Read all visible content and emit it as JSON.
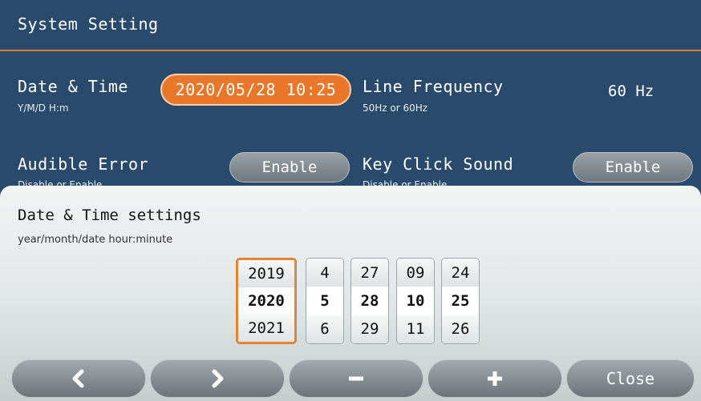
{
  "header": {
    "title": "System Setting"
  },
  "settings": {
    "date_time": {
      "label": "Date & Time",
      "sub": "Y/M/D H:m",
      "value": "2020/05/28 10:25"
    },
    "line_frequency": {
      "label": "Line Frequency",
      "sub": "50Hz or 60Hz",
      "value": "60 Hz"
    },
    "audible_error": {
      "label": "Audible Error",
      "sub": "Disable or Enable",
      "value": "Enable"
    },
    "key_click": {
      "label": "Key Click Sound",
      "sub": "Disable or Enable",
      "value": "Enable"
    }
  },
  "panel": {
    "title": "Date & Time settings",
    "sub": "year/month/date hour:minute",
    "columns": [
      {
        "name": "year",
        "values": [
          "2019",
          "2020",
          "2021"
        ],
        "active": true
      },
      {
        "name": "month",
        "values": [
          "4",
          "5",
          "6"
        ],
        "active": false
      },
      {
        "name": "date",
        "values": [
          "27",
          "28",
          "29"
        ],
        "active": false
      },
      {
        "name": "hour",
        "values": [
          "09",
          "10",
          "11"
        ],
        "active": false
      },
      {
        "name": "minute",
        "values": [
          "24",
          "25",
          "26"
        ],
        "active": false
      }
    ]
  },
  "bottom_bar": {
    "prev_icon": "chevron-left-icon",
    "next_icon": "chevron-right-icon",
    "minus_icon": "minus-icon",
    "plus_icon": "plus-icon",
    "close_label": "Close"
  },
  "colors": {
    "background": "#2a4a6b",
    "accent": "#e8772a"
  }
}
